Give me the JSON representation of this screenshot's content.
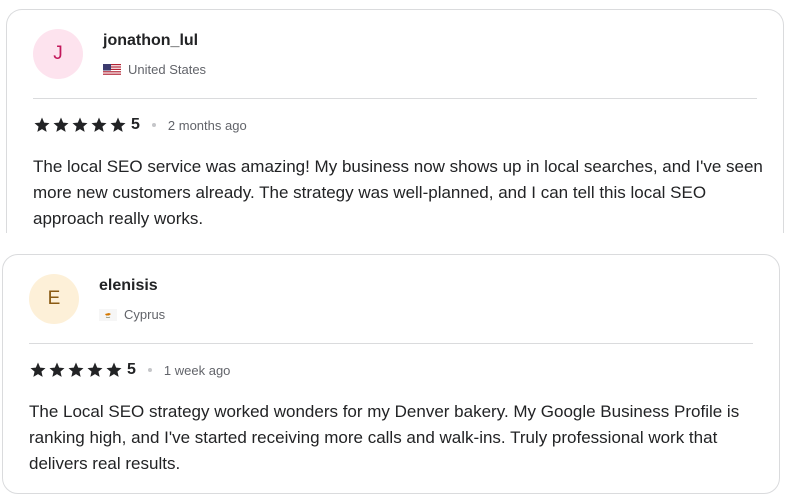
{
  "reviews": [
    {
      "avatar_letter": "J",
      "avatar_bg": "#fde3ee",
      "avatar_color": "#c2185b",
      "username": "jonathon_lul",
      "country": "United States",
      "flag_icon": "us-flag-icon",
      "rating": "5",
      "time": "2 months ago",
      "text": "The local SEO service was amazing! My business now shows up in local searches, and I've seen more new customers already. The strategy was well-planned, and I can tell this local SEO approach really works."
    },
    {
      "avatar_letter": "E",
      "avatar_bg": "#fdf0d8",
      "avatar_color": "#8a5a12",
      "username": "elenisis",
      "country": "Cyprus",
      "flag_icon": "cyprus-flag-icon",
      "rating": "5",
      "time": "1 week ago",
      "text": "The Local SEO strategy worked wonders for my Denver bakery. My Google Business Profile is ranking high, and I've started receiving more calls and walk-ins. Truly professional work that delivers real results."
    }
  ],
  "colors": {
    "star": "#222325",
    "border": "#dadbdd",
    "muted_text": "#62646a"
  }
}
